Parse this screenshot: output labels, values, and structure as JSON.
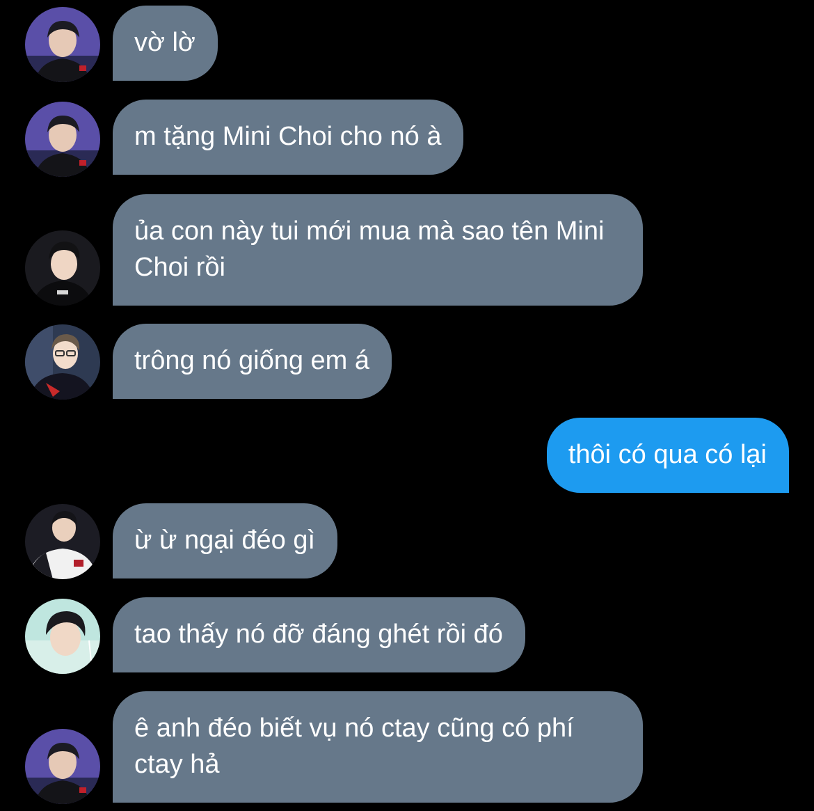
{
  "colors": {
    "background": "#000000",
    "incoming_bubble": "#66788a",
    "outgoing_bubble": "#1d9bf0",
    "text": "#ffffff"
  },
  "messages": [
    {
      "sender": "other",
      "avatar": "avatar-player-purple",
      "text": "vờ lờ"
    },
    {
      "sender": "other",
      "avatar": "avatar-player-purple",
      "text": "m tặng Mini Choi cho nó à"
    },
    {
      "sender": "other",
      "avatar": "avatar-player-dark",
      "text": "ủa con này tui mới mua mà sao tên Mini Choi rồi"
    },
    {
      "sender": "other",
      "avatar": "avatar-player-glasses",
      "text": "trông nó giống em á"
    },
    {
      "sender": "me",
      "avatar": "",
      "text": "thôi có qua có lại"
    },
    {
      "sender": "other",
      "avatar": "avatar-player-jacket",
      "text": "ừ ừ ngại đéo gì"
    },
    {
      "sender": "other",
      "avatar": "avatar-player-light",
      "text": "tao thấy nó đỡ đáng ghét rồi đó"
    },
    {
      "sender": "other",
      "avatar": "avatar-player-purple",
      "text": "ê anh đéo biết vụ nó ctay cũng có phí ctay hả"
    }
  ]
}
